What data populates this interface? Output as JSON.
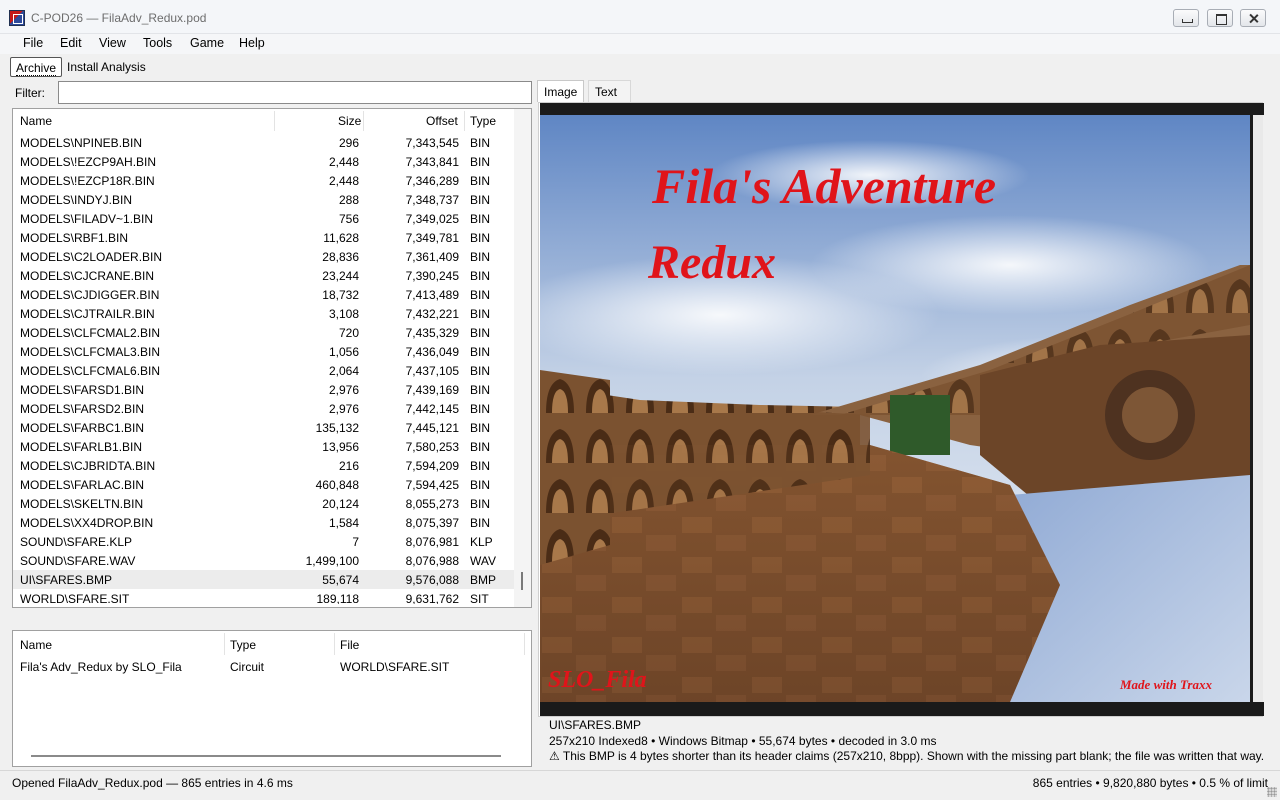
{
  "window": {
    "title": "C-POD26 — FilaAdv_Redux.pod"
  },
  "menu": [
    "File",
    "Edit",
    "View",
    "Tools",
    "Game",
    "Help"
  ],
  "top_tabs": [
    "Archive",
    "Install Analysis"
  ],
  "filter": {
    "label": "Filter:",
    "value": ""
  },
  "file_list": {
    "columns": [
      "Name",
      "Size",
      "Offset",
      "Type"
    ],
    "rows": [
      {
        "name": "MODELS\\NPINEB.BIN",
        "size": "296",
        "offset": "7,343,545",
        "type": "BIN"
      },
      {
        "name": "MODELS\\!EZCP9AH.BIN",
        "size": "2,448",
        "offset": "7,343,841",
        "type": "BIN"
      },
      {
        "name": "MODELS\\!EZCP18R.BIN",
        "size": "2,448",
        "offset": "7,346,289",
        "type": "BIN"
      },
      {
        "name": "MODELS\\INDYJ.BIN",
        "size": "288",
        "offset": "7,348,737",
        "type": "BIN"
      },
      {
        "name": "MODELS\\FILADV~1.BIN",
        "size": "756",
        "offset": "7,349,025",
        "type": "BIN"
      },
      {
        "name": "MODELS\\RBF1.BIN",
        "size": "11,628",
        "offset": "7,349,781",
        "type": "BIN"
      },
      {
        "name": "MODELS\\C2LOADER.BIN",
        "size": "28,836",
        "offset": "7,361,409",
        "type": "BIN"
      },
      {
        "name": "MODELS\\CJCRANE.BIN",
        "size": "23,244",
        "offset": "7,390,245",
        "type": "BIN"
      },
      {
        "name": "MODELS\\CJDIGGER.BIN",
        "size": "18,732",
        "offset": "7,413,489",
        "type": "BIN"
      },
      {
        "name": "MODELS\\CJTRAILR.BIN",
        "size": "3,108",
        "offset": "7,432,221",
        "type": "BIN"
      },
      {
        "name": "MODELS\\CLFCMAL2.BIN",
        "size": "720",
        "offset": "7,435,329",
        "type": "BIN"
      },
      {
        "name": "MODELS\\CLFCMAL3.BIN",
        "size": "1,056",
        "offset": "7,436,049",
        "type": "BIN"
      },
      {
        "name": "MODELS\\CLFCMAL6.BIN",
        "size": "2,064",
        "offset": "7,437,105",
        "type": "BIN"
      },
      {
        "name": "MODELS\\FARSD1.BIN",
        "size": "2,976",
        "offset": "7,439,169",
        "type": "BIN"
      },
      {
        "name": "MODELS\\FARSD2.BIN",
        "size": "2,976",
        "offset": "7,442,145",
        "type": "BIN"
      },
      {
        "name": "MODELS\\FARBC1.BIN",
        "size": "135,132",
        "offset": "7,445,121",
        "type": "BIN"
      },
      {
        "name": "MODELS\\FARLB1.BIN",
        "size": "13,956",
        "offset": "7,580,253",
        "type": "BIN"
      },
      {
        "name": "MODELS\\CJBRIDTA.BIN",
        "size": "216",
        "offset": "7,594,209",
        "type": "BIN"
      },
      {
        "name": "MODELS\\FARLAC.BIN",
        "size": "460,848",
        "offset": "7,594,425",
        "type": "BIN"
      },
      {
        "name": "MODELS\\SKELTN.BIN",
        "size": "20,124",
        "offset": "8,055,273",
        "type": "BIN"
      },
      {
        "name": "MODELS\\XX4DROP.BIN",
        "size": "1,584",
        "offset": "8,075,397",
        "type": "BIN"
      },
      {
        "name": "SOUND\\SFARE.KLP",
        "size": "7",
        "offset": "8,076,981",
        "type": "KLP"
      },
      {
        "name": "SOUND\\SFARE.WAV",
        "size": "1,499,100",
        "offset": "8,076,988",
        "type": "WAV"
      },
      {
        "name": "UI\\SFARES.BMP",
        "size": "55,674",
        "offset": "9,576,088",
        "type": "BMP",
        "selected": true
      },
      {
        "name": "WORLD\\SFARE.SIT",
        "size": "189,118",
        "offset": "9,631,762",
        "type": "SIT"
      }
    ]
  },
  "circuits": {
    "columns": [
      "Name",
      "Type",
      "File"
    ],
    "rows": [
      {
        "name": "Fila's Adv_Redux by SLO_Fila",
        "type": "Circuit",
        "file": "WORLD\\SFARE.SIT"
      }
    ]
  },
  "preview": {
    "tabs": [
      "Image",
      "Text"
    ],
    "image_text": {
      "title_line1": "Fila's Adventure",
      "title_line2": "Redux",
      "author": "SLO_Fila",
      "credit": "Made with Traxx"
    },
    "file_name": "UI\\SFARES.BMP",
    "details": "257x210 Indexed8  •  Windows Bitmap  •  55,674 bytes  •  decoded in 3.0 ms",
    "warning": "⚠ This BMP is 4 bytes shorter than its header claims (257x210, 8bpp). Shown with the missing part blank; the file was written that way."
  },
  "status": {
    "left": "Opened FilaAdv_Redux.pod — 865 entries in 4.6 ms",
    "right": "865 entries  •  9,820,880 bytes  •  0.5 % of limit"
  }
}
